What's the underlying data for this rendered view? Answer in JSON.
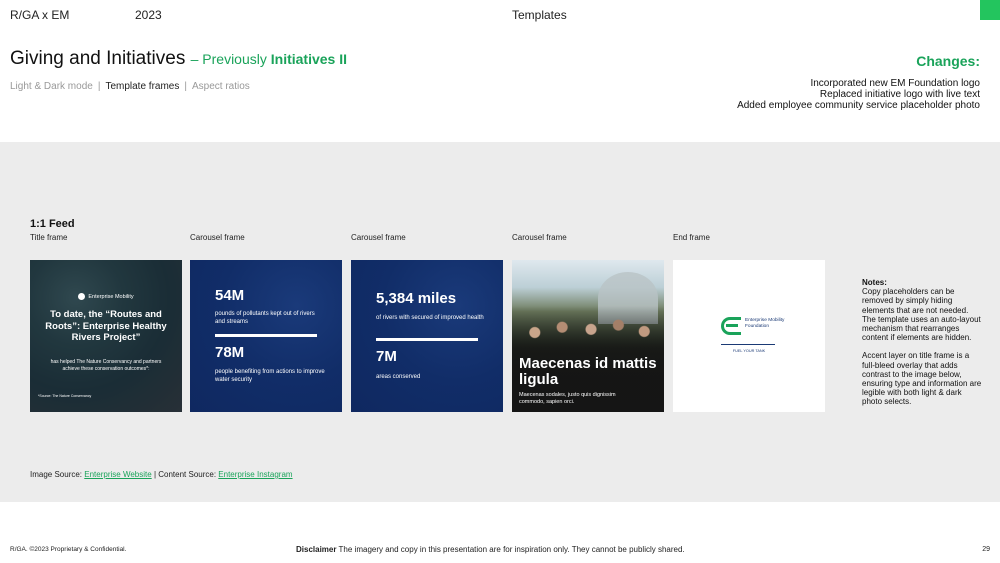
{
  "header": {
    "brand": "R/GA x EM",
    "year": "2023",
    "section": "Templates"
  },
  "title": {
    "main": "Giving and Initiatives",
    "prev_prefix": "– Previously",
    "prev_name": "Initiatives II"
  },
  "nav": {
    "items": [
      "Light & Dark mode",
      "Template frames",
      "Aspect ratios"
    ],
    "active_index": 1
  },
  "changes": {
    "title": "Changes:",
    "lines": [
      "Incorporated new EM Foundation logo",
      "Replaced initiative logo with live text",
      "Added employee community service placeholder photo"
    ]
  },
  "feed": {
    "title": "1:1 Feed",
    "labels": [
      "Title frame",
      "Carousel frame",
      "Carousel frame",
      "Carousel frame",
      "End frame"
    ]
  },
  "frame1": {
    "logo": "Enterprise Mobility",
    "headline": "To date, the “Routes and Roots”: Enterprise Healthy Rivers Project”",
    "sub": "has helped The Nature Conservancy and partners achieve these conservation outcomes*:",
    "source": "*Source: The Nature Conservancy"
  },
  "frame2": {
    "stat1": "54M",
    "desc1": "pounds of pollutants kept out of rivers and streams",
    "stat2": "78M",
    "desc2": "people benefiting from actions to improve water security"
  },
  "frame3": {
    "stat1": "5,384 miles",
    "desc1": "of rivers with secured of improved health",
    "stat2": "7M",
    "desc2": "areas conserved"
  },
  "frame4": {
    "caption": "Maecenas id mattis ligula",
    "sub": "Maecenas sodales, justo quis dignissim commodo, sapien orci."
  },
  "frame5": {
    "logo_text": "Enterprise Mobility Foundation",
    "tagline": "FUEL YOUR TANK"
  },
  "notes": {
    "title": "Notes:",
    "para1": "Copy placeholders can be removed by simply hiding elements that are not needed. The template uses an auto-layout mechanism that rearranges content if elements are hidden.",
    "para2": "Accent layer on title frame is a full-bleed overlay that adds contrast to the image below, ensuring type and information are legible with both light & dark photo selects."
  },
  "source": {
    "prefix": "Image Source:",
    "image_link": "Enterprise Website",
    "sep": "| Content Source:",
    "content_link": "Enterprise Instagram"
  },
  "footer": {
    "left": "R/GA. ©2023 Proprietary & Confidential.",
    "disclaimer_label": "Disclaimer",
    "disclaimer_text": "The imagery and copy in this presentation are for inspiration only. They cannot be publicly shared.",
    "page": "29"
  },
  "colors": {
    "accent": "#1aa35a",
    "green_square": "#23c55e",
    "navy": "#112d68",
    "panel": "#ececec"
  }
}
